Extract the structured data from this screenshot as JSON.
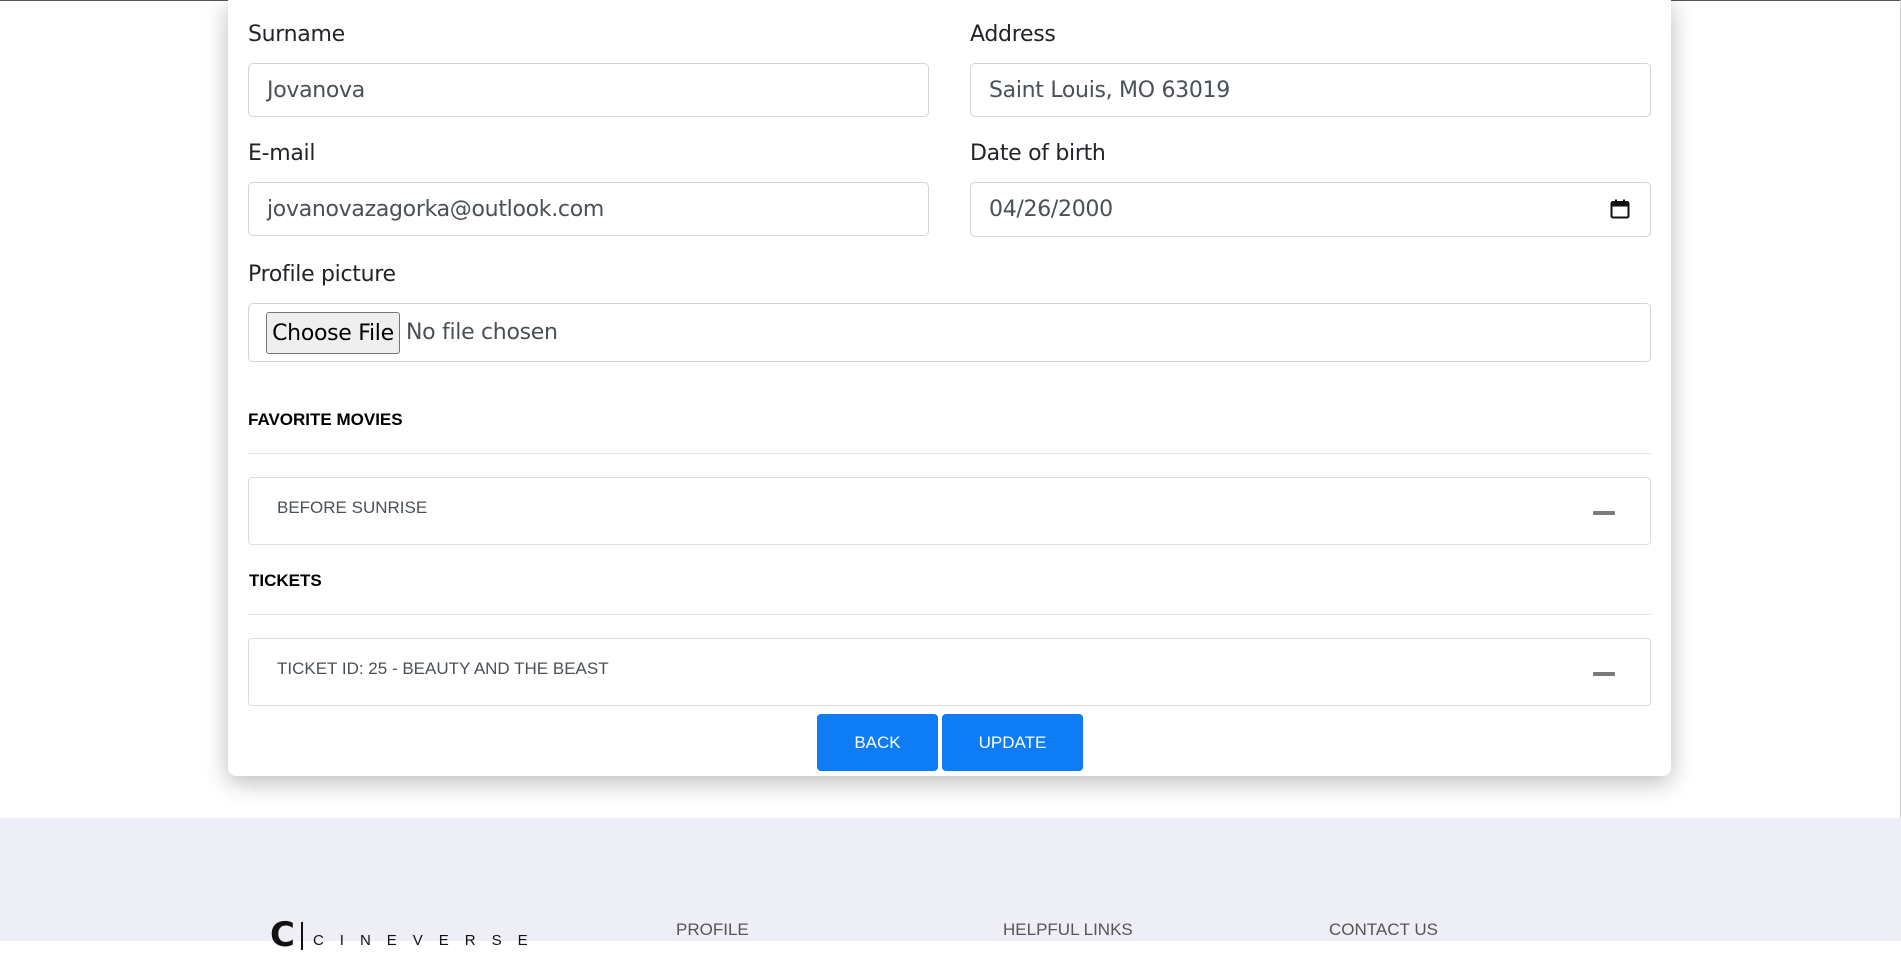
{
  "form": {
    "surname": {
      "label": "Surname",
      "value": "Jovanova"
    },
    "address": {
      "label": "Address",
      "value": "Saint Louis, MO 63019"
    },
    "email": {
      "label": "E-mail",
      "value": "jovanovazagorka@outlook.com"
    },
    "dob": {
      "label": "Date of birth",
      "value": "04/26/2000"
    },
    "profile_picture": {
      "label": "Profile picture",
      "button": "Choose File",
      "status": "No file chosen"
    }
  },
  "favorite_movies": {
    "title": "FAVORITE MOVIES",
    "items": [
      {
        "label": "BEFORE SUNRISE"
      }
    ]
  },
  "tickets": {
    "title": "TICKETS",
    "items": [
      {
        "label": "TICKET ID: 25 - BEAUTY AND THE BEAST"
      }
    ]
  },
  "actions": {
    "back": "BACK",
    "update": "UPDATE"
  },
  "footer": {
    "brand_initial": "C",
    "brand_name": "CINEVERSE",
    "columns": [
      "PROFILE",
      "HELPFUL LINKS",
      "CONTACT US"
    ]
  },
  "colors": {
    "primary": "#0d7cf5",
    "footer_bg": "#eeeef7"
  }
}
